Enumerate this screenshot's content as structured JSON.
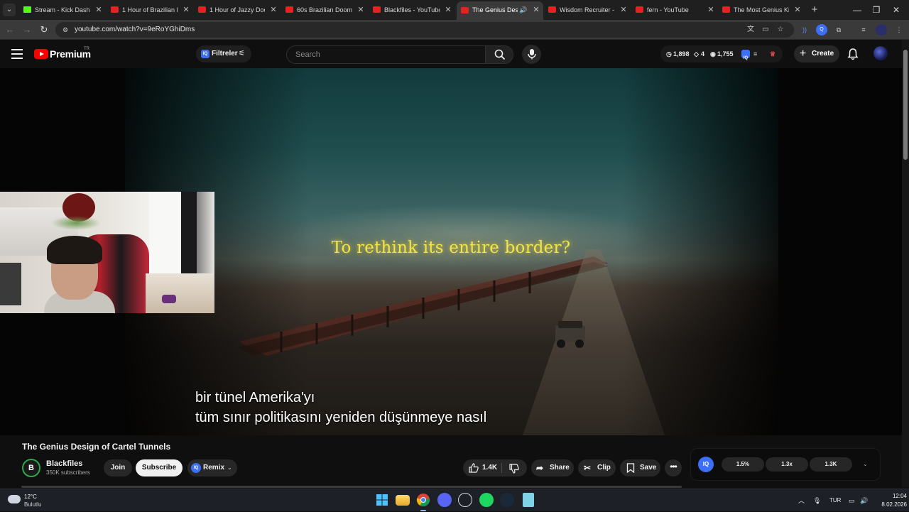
{
  "browser": {
    "tabs": [
      {
        "title": "Stream - Kick Dashbo",
        "favicon": "kick-icon",
        "active": false
      },
      {
        "title": "1 Hour of Brazilian Bl",
        "favicon": "youtube-icon",
        "active": false
      },
      {
        "title": "1 Hour of Jazzy Doom",
        "favicon": "youtube-icon",
        "active": false
      },
      {
        "title": "60s Brazilian Doomer",
        "favicon": "youtube-icon",
        "active": false
      },
      {
        "title": "Blackfiles - YouTube",
        "favicon": "youtube-icon",
        "active": false
      },
      {
        "title": "The Genius Desig",
        "favicon": "youtube-icon",
        "active": true,
        "audio": true
      },
      {
        "title": "Wisdom Recruiter - Y",
        "favicon": "youtube-icon",
        "active": false
      },
      {
        "title": "fern - YouTube",
        "favicon": "youtube-icon",
        "active": false
      },
      {
        "title": "The Most Genius Kid",
        "favicon": "youtube-icon",
        "active": false
      }
    ],
    "url": "youtube.com/watch?v=9eRoYGhiDms"
  },
  "youtube": {
    "logo_text": "Premium",
    "region": "TR",
    "filter_label": "Filtreler",
    "search_placeholder": "Search",
    "stats": {
      "views": "1,898",
      "comments": "4",
      "watch": "1,755"
    },
    "create_label": "Create"
  },
  "video": {
    "overlay_title": "To rethink its entire border?",
    "captions": [
      "bir tünel Amerika'yı",
      "tüm sınır politikasını yeniden düşünmeye nasıl"
    ],
    "title": "The Genius Design of Cartel Tunnels"
  },
  "channel": {
    "initial": "B",
    "name": "Blackfiles",
    "subscribers": "350K subscribers",
    "join_label": "Join",
    "subscribe_label": "Subscribe",
    "remix_label": "Remix"
  },
  "actions": {
    "likes": "1.4K",
    "share_label": "Share",
    "clip_label": "Clip",
    "save_label": "Save"
  },
  "extension_panel": {
    "badge": "IQ",
    "stats": [
      "1.5%",
      "1.3x",
      "1.3K"
    ]
  },
  "taskbar": {
    "weather_temp": "12°C",
    "weather_cond": "Bulutlu",
    "language": "TUR",
    "time": "12:04",
    "date": "8.02.2026"
  },
  "colors": {
    "youtube_red": "#ff0000",
    "accent_blue": "#3b6ff5",
    "overlay_yellow": "#f2e54a",
    "background": "#0f0f0f"
  }
}
